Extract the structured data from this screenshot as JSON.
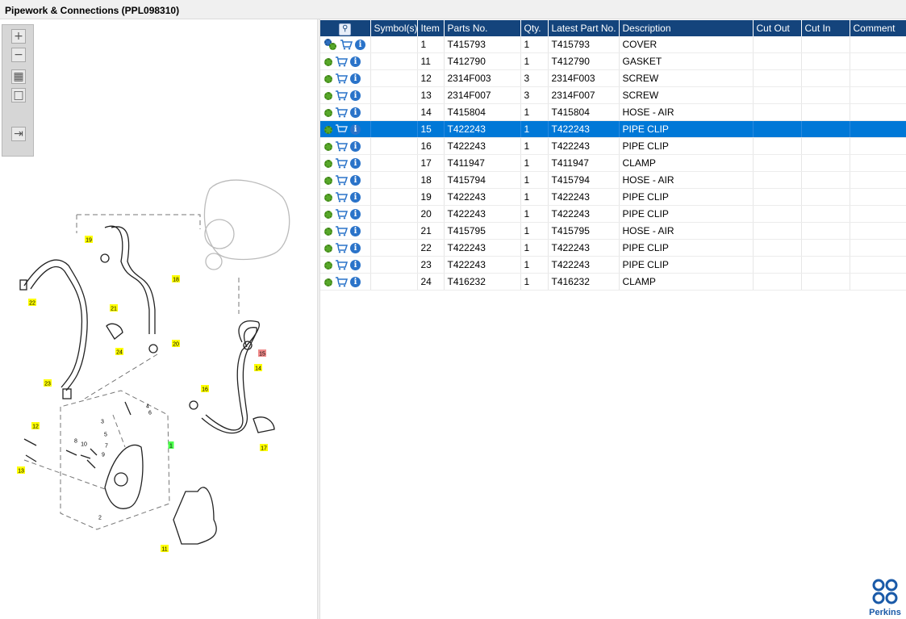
{
  "window": {
    "title": "Pipework & Connections (PPL098310)"
  },
  "toolbox": {
    "buttons": [
      {
        "icon": "zoom-in-icon",
        "glyph": "+"
      },
      {
        "icon": "zoom-out-icon",
        "glyph": "−"
      },
      {
        "icon": "fit-all-icon",
        "glyph": "▦"
      },
      {
        "icon": "actual-size-icon",
        "glyph": "□"
      },
      {
        "icon": "export-icon",
        "glyph": "⇥"
      }
    ]
  },
  "diagram": {
    "callouts": [
      {
        "text": "19",
        "hl": "yellow"
      },
      {
        "text": "18",
        "hl": "yellow"
      },
      {
        "text": "22",
        "hl": "yellow"
      },
      {
        "text": "21",
        "hl": "yellow"
      },
      {
        "text": "24",
        "hl": "yellow"
      },
      {
        "text": "20",
        "hl": "yellow"
      },
      {
        "text": "15",
        "hl": "red"
      },
      {
        "text": "14",
        "hl": "yellow"
      },
      {
        "text": "23",
        "hl": "yellow"
      },
      {
        "text": "16",
        "hl": "yellow"
      },
      {
        "text": "12",
        "hl": "yellow"
      },
      {
        "text": "1",
        "hl": "green"
      },
      {
        "text": "17",
        "hl": "yellow"
      },
      {
        "text": "13",
        "hl": "yellow"
      },
      {
        "text": "11",
        "hl": "yellow"
      },
      {
        "text": "4",
        "hl": "none"
      },
      {
        "text": "6",
        "hl": "none"
      },
      {
        "text": "3",
        "hl": "none"
      },
      {
        "text": "5",
        "hl": "none"
      },
      {
        "text": "8",
        "hl": "none"
      },
      {
        "text": "10",
        "hl": "none"
      },
      {
        "text": "7",
        "hl": "none"
      },
      {
        "text": "9",
        "hl": "none"
      },
      {
        "text": "2",
        "hl": "none"
      }
    ]
  },
  "table": {
    "columns": [
      "",
      "Symbol(s)",
      "Item",
      "Parts No.",
      "Qty.",
      "Latest Part No.",
      "Description",
      "Cut Out",
      "Cut In",
      "Comment"
    ],
    "rows": [
      {
        "item": "1",
        "part": "T415793",
        "qty": "1",
        "latest": "T415793",
        "desc": "COVER",
        "multi": true
      },
      {
        "item": "11",
        "part": "T412790",
        "qty": "1",
        "latest": "T412790",
        "desc": "GASKET"
      },
      {
        "item": "12",
        "part": "2314F003",
        "qty": "3",
        "latest": "2314F003",
        "desc": "SCREW"
      },
      {
        "item": "13",
        "part": "2314F007",
        "qty": "3",
        "latest": "2314F007",
        "desc": "SCREW"
      },
      {
        "item": "14",
        "part": "T415804",
        "qty": "1",
        "latest": "T415804",
        "desc": "HOSE - AIR"
      },
      {
        "item": "15",
        "part": "T422243",
        "qty": "1",
        "latest": "T422243",
        "desc": "PIPE CLIP",
        "selected": true
      },
      {
        "item": "16",
        "part": "T422243",
        "qty": "1",
        "latest": "T422243",
        "desc": "PIPE CLIP"
      },
      {
        "item": "17",
        "part": "T411947",
        "qty": "1",
        "latest": "T411947",
        "desc": "CLAMP"
      },
      {
        "item": "18",
        "part": "T415794",
        "qty": "1",
        "latest": "T415794",
        "desc": "HOSE - AIR"
      },
      {
        "item": "19",
        "part": "T422243",
        "qty": "1",
        "latest": "T422243",
        "desc": "PIPE CLIP"
      },
      {
        "item": "20",
        "part": "T422243",
        "qty": "1",
        "latest": "T422243",
        "desc": "PIPE CLIP"
      },
      {
        "item": "21",
        "part": "T415795",
        "qty": "1",
        "latest": "T415795",
        "desc": "HOSE - AIR"
      },
      {
        "item": "22",
        "part": "T422243",
        "qty": "1",
        "latest": "T422243",
        "desc": "PIPE CLIP"
      },
      {
        "item": "23",
        "part": "T422243",
        "qty": "1",
        "latest": "T422243",
        "desc": "PIPE CLIP"
      },
      {
        "item": "24",
        "part": "T416232",
        "qty": "1",
        "latest": "T416232",
        "desc": "CLAMP"
      }
    ]
  },
  "logo": {
    "text": "Perkins"
  },
  "colors": {
    "header": "#14447c",
    "selected": "#0078d7",
    "highlight_yellow": "#ffff00",
    "highlight_red": "#f08a8a",
    "highlight_green": "#4cff4c"
  }
}
